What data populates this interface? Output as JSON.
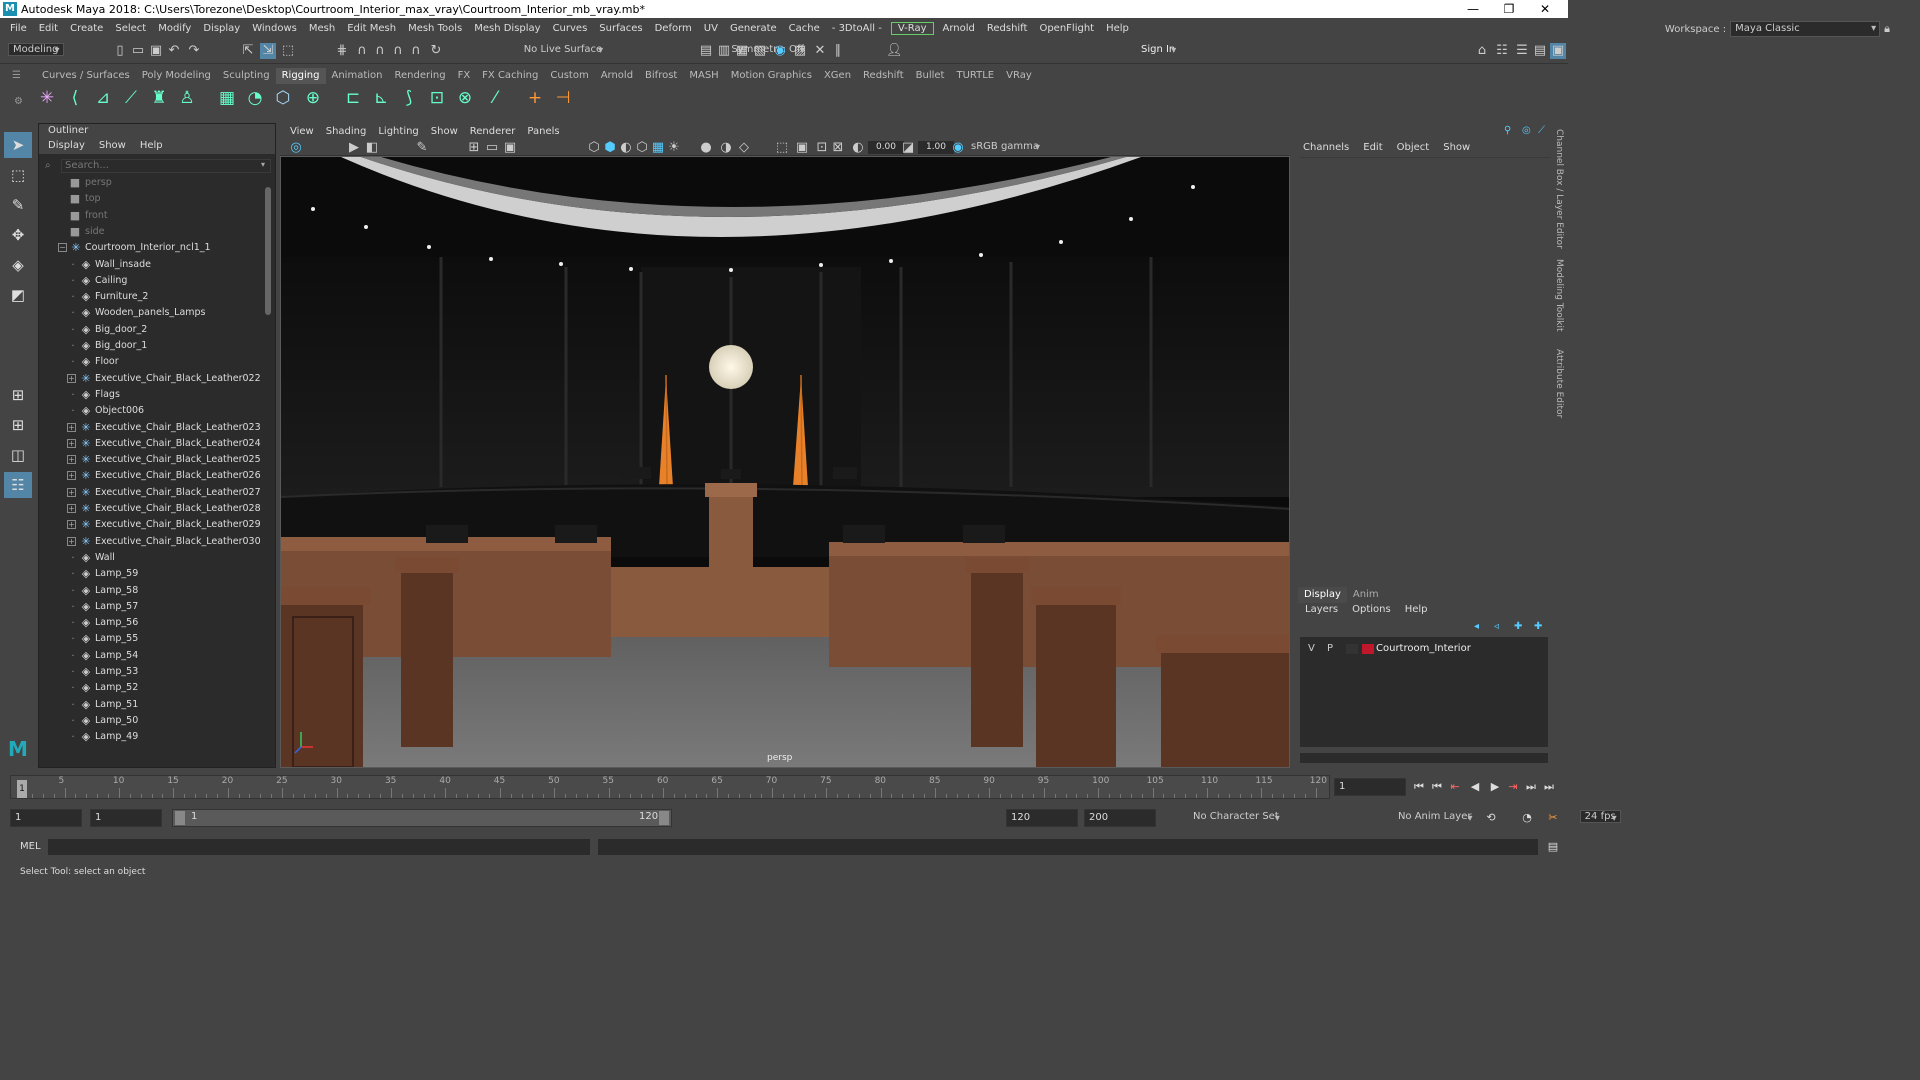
{
  "window": {
    "title": "Autodesk Maya 2018: C:\\Users\\Torezone\\Desktop\\Courtroom_Interior_max_vray\\Courtroom_Interior_mb_vray.mb*",
    "logo": "M"
  },
  "menubar": {
    "items": [
      "File",
      "Edit",
      "Create",
      "Select",
      "Modify",
      "Display",
      "Windows",
      "Mesh",
      "Edit Mesh",
      "Mesh Tools",
      "Mesh Display",
      "Curves",
      "Surfaces",
      "Deform",
      "UV",
      "Generate",
      "Cache",
      "- 3DtoAll -"
    ],
    "vray": "V-Ray",
    "items2": [
      "Arnold",
      "Redshift",
      "OpenFlight",
      "Help"
    ],
    "workspace_label": "Workspace :",
    "workspace_value": "Maya Classic"
  },
  "statusline": {
    "mode": "Modeling",
    "live_surface": "No Live Surface",
    "symmetry": "Symmetry: Off",
    "sign_in": "Sign In"
  },
  "shelf": {
    "tabs": [
      "Curves / Surfaces",
      "Poly Modeling",
      "Sculpting",
      "Rigging",
      "Animation",
      "Rendering",
      "FX",
      "FX Caching",
      "Custom",
      "Arnold",
      "Bifrost",
      "MASH",
      "Motion Graphics",
      "XGen",
      "Redshift",
      "Bullet",
      "TURTLE",
      "VRay"
    ],
    "active_tab": "Rigging"
  },
  "outliner": {
    "title": "Outliner",
    "menu": [
      "Display",
      "Show",
      "Help"
    ],
    "search_placeholder": "Search...",
    "cameras": [
      "persp",
      "top",
      "front",
      "side"
    ],
    "root": "Courtroom_Interior_ncl1_1",
    "items": [
      {
        "label": "Wall_insade",
        "type": "mesh"
      },
      {
        "label": "Cailing",
        "type": "mesh"
      },
      {
        "label": "Furniture_2",
        "type": "mesh"
      },
      {
        "label": "Wooden_panels_Lamps",
        "type": "mesh"
      },
      {
        "label": "Big_door_2",
        "type": "mesh"
      },
      {
        "label": "Big_door_1",
        "type": "mesh"
      },
      {
        "label": "Floor",
        "type": "mesh"
      },
      {
        "label": "Executive_Chair_Black_Leather022",
        "type": "group"
      },
      {
        "label": "Flags",
        "type": "mesh"
      },
      {
        "label": "Object006",
        "type": "mesh"
      },
      {
        "label": "Executive_Chair_Black_Leather023",
        "type": "group"
      },
      {
        "label": "Executive_Chair_Black_Leather024",
        "type": "group"
      },
      {
        "label": "Executive_Chair_Black_Leather025",
        "type": "group"
      },
      {
        "label": "Executive_Chair_Black_Leather026",
        "type": "group"
      },
      {
        "label": "Executive_Chair_Black_Leather027",
        "type": "group"
      },
      {
        "label": "Executive_Chair_Black_Leather028",
        "type": "group"
      },
      {
        "label": "Executive_Chair_Black_Leather029",
        "type": "group"
      },
      {
        "label": "Executive_Chair_Black_Leather030",
        "type": "group"
      },
      {
        "label": "Wall",
        "type": "mesh"
      },
      {
        "label": "Lamp_59",
        "type": "mesh"
      },
      {
        "label": "Lamp_58",
        "type": "mesh"
      },
      {
        "label": "Lamp_57",
        "type": "mesh"
      },
      {
        "label": "Lamp_56",
        "type": "mesh"
      },
      {
        "label": "Lamp_55",
        "type": "mesh"
      },
      {
        "label": "Lamp_54",
        "type": "mesh"
      },
      {
        "label": "Lamp_53",
        "type": "mesh"
      },
      {
        "label": "Lamp_52",
        "type": "mesh"
      },
      {
        "label": "Lamp_51",
        "type": "mesh"
      },
      {
        "label": "Lamp_50",
        "type": "mesh"
      },
      {
        "label": "Lamp_49",
        "type": "mesh"
      }
    ]
  },
  "viewport": {
    "menu": [
      "View",
      "Shading",
      "Lighting",
      "Show",
      "Renderer",
      "Panels"
    ],
    "exposure": "0.00",
    "gamma": "1.00",
    "color_space": "sRGB gamma",
    "camera_label": "persp"
  },
  "channelbox": {
    "menu": [
      "Channels",
      "Edit",
      "Object",
      "Show"
    ],
    "side_tabs": [
      "Channel Box / Layer Editor",
      "Modeling Toolkit",
      "Attribute Editor"
    ]
  },
  "layers": {
    "tabs": [
      "Display",
      "Anim"
    ],
    "active_tab": "Display",
    "menu": [
      "Layers",
      "Options",
      "Help"
    ],
    "layer_v": "V",
    "layer_p": "P",
    "layer_name": "Courtroom_Interior",
    "layer_color": "#c0182a"
  },
  "timeline": {
    "ticks": [
      "5",
      "10",
      "15",
      "20",
      "25",
      "30",
      "35",
      "40",
      "45",
      "50",
      "55",
      "60",
      "65",
      "70",
      "75",
      "80",
      "85",
      "90",
      "95",
      "100",
      "105",
      "110",
      "115",
      "120"
    ],
    "current_frame_marker": "1",
    "current_frame": "1"
  },
  "range": {
    "start": "1",
    "playback_start": "1",
    "slider_start": "1",
    "slider_end": "120",
    "playback_end": "120",
    "end": "200",
    "character_set": "No Character Set",
    "anim_layer": "No Anim Layer",
    "fps": "24 fps"
  },
  "cmdline": {
    "label": "MEL"
  },
  "helpline": {
    "text": "Select Tool: select an object"
  }
}
